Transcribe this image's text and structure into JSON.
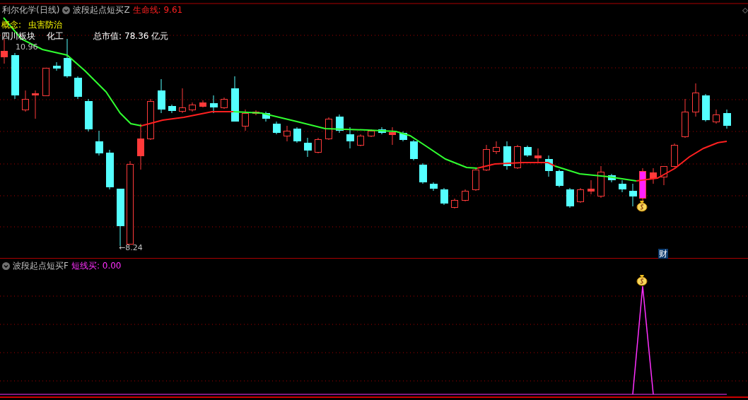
{
  "chart_title": "利尔化学(日线)",
  "indicator": {
    "name": "波段起点短买Z",
    "label": "生命线:",
    "value": "9.61"
  },
  "info": {
    "concept_label": "概念:",
    "concept": "虫害防治",
    "sector": "四川板块",
    "industry": "化工",
    "cap_label": "总市值:",
    "cap_value": "78.36 亿元"
  },
  "price_labels": {
    "high": "10.96",
    "low": "←8.24"
  },
  "signal_badge": "财",
  "lower": {
    "name": "波段起点短买F",
    "label": "短线买:",
    "value": "0.00"
  }
}
